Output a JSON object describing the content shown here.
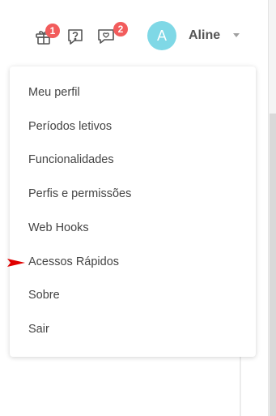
{
  "header": {
    "icons": [
      {
        "name": "gift-icon",
        "badge": "1"
      },
      {
        "name": "help-icon",
        "badge": ""
      },
      {
        "name": "chat-icon",
        "badge": "2"
      }
    ],
    "user": {
      "avatar_letter": "A",
      "name": "Aline"
    }
  },
  "menu": {
    "items": [
      {
        "label": "Meu perfil"
      },
      {
        "label": "Períodos letivos"
      },
      {
        "label": "Funcionalidades"
      },
      {
        "label": "Perfis e permissões"
      },
      {
        "label": "Web Hooks"
      },
      {
        "label": "Acessos Rápidos"
      },
      {
        "label": "Sobre"
      },
      {
        "label": "Sair"
      }
    ]
  },
  "colors": {
    "badge": "#f25c5c",
    "avatar": "#7fd8e6",
    "pointer": "#e00000"
  }
}
